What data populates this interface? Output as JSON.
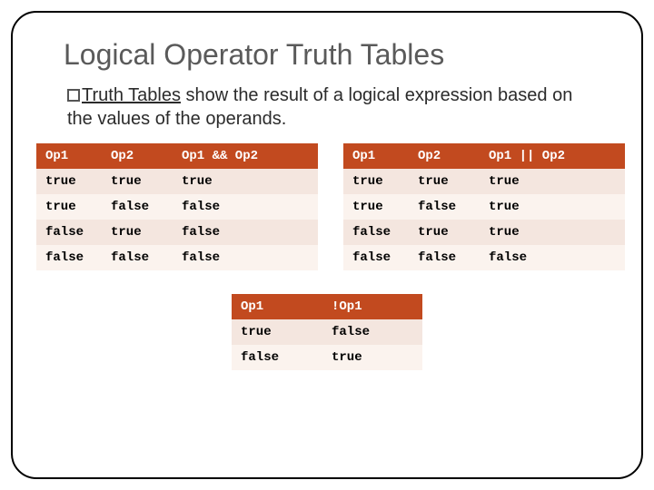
{
  "title": "Logical Operator Truth Tables",
  "body": {
    "underlined": "Truth Tables",
    "rest": " show the result of a logical expression based on the values of the operands."
  },
  "tables": {
    "and": {
      "headers": [
        "Op1",
        "Op2",
        "Op1 && Op2"
      ],
      "rows": [
        [
          "true",
          "true",
          "true"
        ],
        [
          "true",
          "false",
          "false"
        ],
        [
          "false",
          "true",
          "false"
        ],
        [
          "false",
          "false",
          "false"
        ]
      ]
    },
    "or": {
      "headers": [
        "Op1",
        "Op2",
        "Op1 || Op2"
      ],
      "rows": [
        [
          "true",
          "true",
          "true"
        ],
        [
          "true",
          "false",
          "true"
        ],
        [
          "false",
          "true",
          "true"
        ],
        [
          "false",
          "false",
          "false"
        ]
      ]
    },
    "not": {
      "headers": [
        "Op1",
        "!Op1"
      ],
      "rows": [
        [
          "true",
          "false"
        ],
        [
          "false",
          "true"
        ]
      ]
    }
  }
}
